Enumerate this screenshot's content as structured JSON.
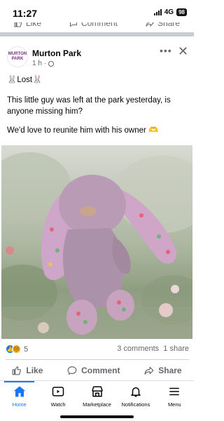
{
  "status_bar": {
    "time": "11:27",
    "network": "4G",
    "battery": "98"
  },
  "top_actions": {
    "like": "Like",
    "comment": "Comment",
    "share": "Share"
  },
  "post": {
    "page_name": "Murton Park",
    "avatar_text_1": "MURTON",
    "avatar_text_2": "PARK",
    "time": "1 h ·",
    "title": "🐰Lost🐰",
    "paragraph_1": "This little guy was left at the park yesterday, is anyone missing him?",
    "paragraph_2": "We'd love to reunite him with his owner 🫶",
    "reaction_count": "5",
    "comments": "3 comments",
    "shares": "1 share"
  },
  "actions": {
    "like": "Like",
    "comment": "Comment",
    "share": "Share"
  },
  "nav": {
    "home": "Home",
    "watch": "Watch",
    "marketplace": "Marketplace",
    "notifications": "Notifications",
    "menu": "Menu"
  },
  "colors": {
    "accent": "#1877f2",
    "secondary_text": "#65676b"
  }
}
